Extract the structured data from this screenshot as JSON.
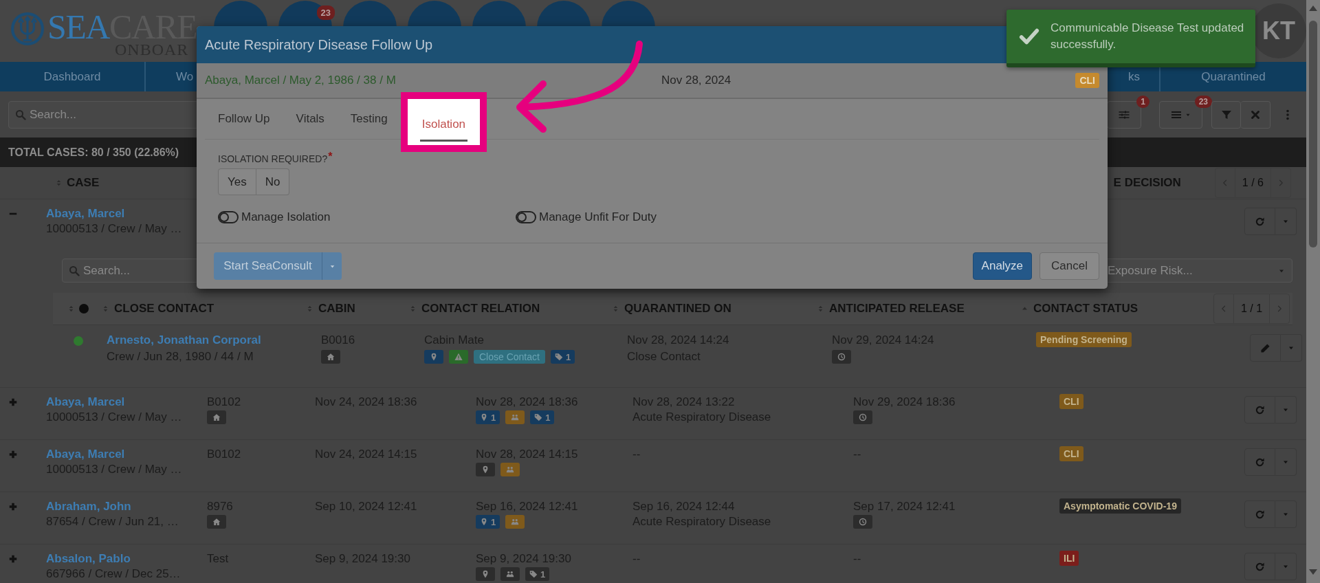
{
  "logo": {
    "brand_primary": "SEA",
    "brand_secondary": "CARE",
    "subtitle": "ONBOAR"
  },
  "nav_buttons": [
    {
      "kind": "circle"
    },
    {
      "kind": "circle",
      "badge": "23"
    },
    {
      "kind": "circle"
    },
    {
      "kind": "circle"
    },
    {
      "kind": "circle"
    },
    {
      "kind": "circle"
    },
    {
      "kind": "circle"
    }
  ],
  "user": {
    "initials": "KT"
  },
  "nav_tabs": [
    {
      "label": "Dashboard",
      "selected": false
    },
    {
      "label": "Wo",
      "selected": false
    },
    {
      "label": "ks",
      "selected": false
    },
    {
      "label": "Quarantined",
      "selected": false
    }
  ],
  "toolbar": {
    "search": {
      "placeholder": "Search..."
    },
    "buttons": [
      {
        "kind": "sliders",
        "badge": "1"
      },
      {
        "kind": "list",
        "badge": "23"
      },
      {
        "kind": "filter"
      },
      {
        "kind": "clear"
      },
      {
        "kind": "more"
      }
    ]
  },
  "summary": "TOTAL CASES: 80 / 350 (22.86%)",
  "table": {
    "columns": [
      {
        "label": "CASE"
      },
      {
        "label": "E DECISION"
      }
    ],
    "pager": "1 / 6",
    "rows": [
      {
        "expanded": true,
        "name": "Abaya, Marcel",
        "details": "10000513 / Crew / May …",
        "action": {
          "kind": "refresh"
        },
        "contacts": {
          "search": {
            "placeholder": "Search..."
          },
          "filter": {
            "placeholder": "Exposure Risk..."
          },
          "columns": [
            {
              "kind": "dot"
            },
            {
              "kind": "text",
              "label": "CLOSE CONTACT",
              "sorted_ascending": false
            },
            {
              "kind": "text",
              "label": "CABIN",
              "sorted_ascending": false
            },
            {
              "kind": "text",
              "label": "CONTACT RELATION",
              "sorted_ascending": false
            },
            {
              "kind": "text",
              "label": "QUARANTINED ON",
              "sorted_ascending": false
            },
            {
              "kind": "text",
              "label": "ANTICIPATED RELEASE",
              "sorted_ascending": false
            },
            {
              "kind": "text",
              "label": "CONTACT STATUS",
              "sorted_ascending": true
            }
          ],
          "pager": "1 / 1",
          "rows": [
            {
              "color": "#2f7a2f",
              "name": "Arnesto, Jonathan Corporal",
              "details": "Crew / Jun 28, 1980 / 44 / M",
              "cabin": "B0016",
              "cabin_badges": [
                {
                  "kind": "home",
                  "color": "#2c2c2c"
                }
              ],
              "relation": "Cabin Mate",
              "relation_badges": [
                {
                  "kind": "pin",
                  "color": "#153b5e"
                },
                {
                  "kind": "warning",
                  "color": "#2a6a2a"
                },
                {
                  "kind": "text",
                  "label": "Close Contact",
                  "color": "#2f7080"
                },
                {
                  "kind": "tag",
                  "color": "#153b5e",
                  "count": "1"
                }
              ],
              "quarantined": "Nov 28, 2024 14:24",
              "reason": "Close Contact",
              "release": "Nov 29, 2024 14:24",
              "release_badges": [
                {
                  "kind": "clock",
                  "color": "#2c2c2c"
                }
              ],
              "status": {
                "label": "Pending Screening",
                "color": "#7f5a1b"
              },
              "action": {
                "kind": "edit"
              }
            }
          ]
        }
      },
      {
        "expanded": false,
        "name": "Abaya, Marcel",
        "details": "10000513 / Crew / May …",
        "cabin": "B0102",
        "cabin_badges": [
          {
            "kind": "home",
            "color": "#2c2c2c"
          }
        ],
        "created": "Nov 24, 2024 18:36",
        "contact_date": "Nov 28, 2024 18:36",
        "contact_badges": [
          {
            "kind": "pin",
            "color": "#153b5e",
            "count": "1"
          },
          {
            "kind": "people",
            "color": "#7f5a1b"
          },
          {
            "kind": "tag",
            "color": "#153b5e",
            "count": "1"
          }
        ],
        "diagnosed": "Nov 28, 2024 13:22",
        "reason": "Acute Respiratory Disease",
        "release": "Nov 29, 2024 18:36",
        "release_badges": [
          {
            "kind": "clock",
            "color": "#2c2c2c"
          }
        ],
        "status": {
          "label": "CLI",
          "color": "#7f5a1b"
        },
        "action": {
          "kind": "refresh"
        }
      },
      {
        "expanded": false,
        "name": "Abaya, Marcel",
        "details": "10000513 / Crew / May …",
        "cabin": "B0102",
        "created": "Nov 24, 2024 14:15",
        "contact_date": "Nov 28, 2024 14:15",
        "contact_badges": [
          {
            "kind": "pin",
            "color": "#2c2c2c"
          },
          {
            "kind": "people",
            "color": "#7f5a1b"
          }
        ],
        "diagnosed": "--",
        "release": "--",
        "status": {
          "label": "CLI",
          "color": "#7f5a1b"
        },
        "action": {
          "kind": "refresh"
        }
      },
      {
        "expanded": false,
        "name": "Abraham, John",
        "details": "87654 / Crew / Jun 21, …",
        "cabin": "8976",
        "cabin_badges": [
          {
            "kind": "home",
            "color": "#2c2c2c"
          }
        ],
        "created": "Sep 10, 2024 12:41",
        "contact_date": "Sep 16, 2024 12:41",
        "contact_badges": [
          {
            "kind": "pin",
            "color": "#153b5e",
            "count": "1"
          },
          {
            "kind": "people",
            "color": "#7f5a1b"
          }
        ],
        "diagnosed": "Sep 16, 2024 12:44",
        "reason": "Acute Respiratory Disease",
        "release": "Sep 17, 2024 12:41",
        "release_badges": [
          {
            "kind": "clock",
            "color": "#2c2c2c"
          }
        ],
        "status": {
          "label": "Asymptomatic COVID-19",
          "color": "#262626"
        },
        "action": {
          "kind": "refresh"
        }
      },
      {
        "expanded": false,
        "name": "Absalon, Pablo",
        "details": "667966 / Crew / Dec 25…",
        "cabin": "Test",
        "created": "Sep 9, 2024 19:30",
        "contact_date": "Sep 9, 2024 19:30",
        "contact_badges": [
          {
            "kind": "pin",
            "color": "#2c2c2c"
          },
          {
            "kind": "people",
            "color": "#2c2c2c"
          },
          {
            "kind": "tag",
            "color": "#2c2c2c",
            "count": "1"
          }
        ],
        "diagnosed": "--",
        "release": "--",
        "status": {
          "label": "ILI",
          "color": "#7b1e1b"
        },
        "action": {
          "kind": "refresh"
        }
      }
    ]
  },
  "modal": {
    "title": "Acute Respiratory Disease Follow Up",
    "patient": "Abaya, Marcel / May 2, 1986 / 38 / M",
    "date": "Nov 28, 2024",
    "badge": {
      "label": "CLI",
      "color": "#c58a2e"
    },
    "tabs": [
      {
        "label": "Follow Up",
        "selected": false,
        "highlighted": false
      },
      {
        "label": "Vitals",
        "selected": false,
        "highlighted": false
      },
      {
        "label": "Testing",
        "selected": false,
        "highlighted": false
      },
      {
        "label": "Isolation",
        "selected": true,
        "highlighted": true
      }
    ],
    "question": {
      "label": "ISOLATION REQUIRED?",
      "required_mark": "*",
      "options": [
        {
          "label": "Yes",
          "selected": false
        },
        {
          "label": "No",
          "selected": false
        }
      ]
    },
    "toggles": [
      {
        "label": "Manage Isolation",
        "on": false
      },
      {
        "label": "Manage Unfit For Duty",
        "on": false
      }
    ],
    "consult": "Start SeaConsult",
    "buttons": [
      {
        "label": "Analyze",
        "kind": "primary"
      },
      {
        "label": "Cancel",
        "kind": "default"
      }
    ]
  },
  "toast": {
    "kind": "success",
    "message": "Communicable Disease Test updated successfully."
  },
  "annotation": {
    "kind": "arrow"
  }
}
